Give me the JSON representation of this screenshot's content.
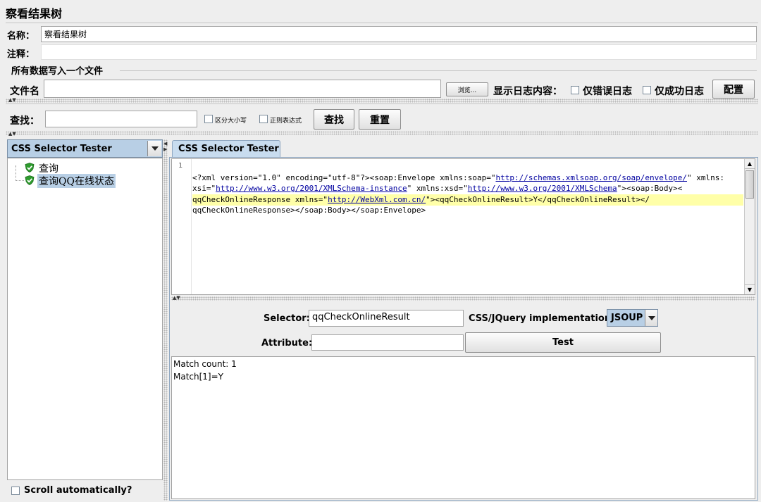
{
  "title": "察看结果树",
  "form": {
    "name_label": "名称：",
    "name_value": "察看结果树",
    "comment_label": "注释：",
    "comment_value": ""
  },
  "file_section": {
    "legend": "所有数据写入一个文件",
    "filename_label": "文件名",
    "filename_value": "",
    "browse_label": "浏览...",
    "log_display_label": "显示日志内容：",
    "errors_only_label": "仅错误日志",
    "success_only_label": "仅成功日志",
    "configure_label": "配置"
  },
  "search": {
    "label": "查找：",
    "value": "",
    "case_sensitive_label": "区分大小写",
    "regex_label": "正则表达式",
    "find_label": "查找",
    "reset_label": "重置"
  },
  "left_panel": {
    "renderer_selected": "CSS Selector Tester",
    "tree": [
      {
        "label": "查询",
        "status": "success"
      },
      {
        "label": "查询QQ在线状态",
        "status": "success",
        "selected": true
      }
    ],
    "scroll_auto_label": "Scroll automatically?"
  },
  "right_panel": {
    "tab_label": "CSS Selector Tester",
    "line_number": "1",
    "xml": {
      "p1": "<?xml version=\"1.0\" encoding=\"utf-8\"?><soap:Envelope xmlns:soap=\"",
      "u1": "http://schemas.xmlsoap.org/soap/envelope/",
      "p2": "\" xmlns:",
      "p3": "xsi=\"",
      "u2": "http://www.w3.org/2001/XMLSchema-instance",
      "p4": "\" xmlns:xsd=\"",
      "u3": "http://www.w3.org/2001/XMLSchema",
      "p5": "\"><soap:Body><",
      "p6": "qqCheckOnlineResponse xmlns=\"",
      "u4": "http://WebXml.com.cn/",
      "p7": "\"><qqCheckOnlineResult>Y</qqCheckOnlineResult></",
      "p8": "qqCheckOnlineResponse></soap:Body></soap:Envelope>"
    },
    "selector_label": "Selector:",
    "selector_value": "qqCheckOnlineResult",
    "impl_label": "CSS/JQuery implementation:",
    "impl_value": "JSOUP",
    "attribute_label": "Attribute:",
    "attribute_value": "",
    "test_label": "Test",
    "result_line1": "Match count: 1",
    "result_line2": "Match[1]=Y"
  },
  "colors": {
    "accent": "#b8cfe5",
    "tab_bg": "#c8dcef",
    "highlight_line": "#ffffa8",
    "success": "#2e9b2e"
  }
}
